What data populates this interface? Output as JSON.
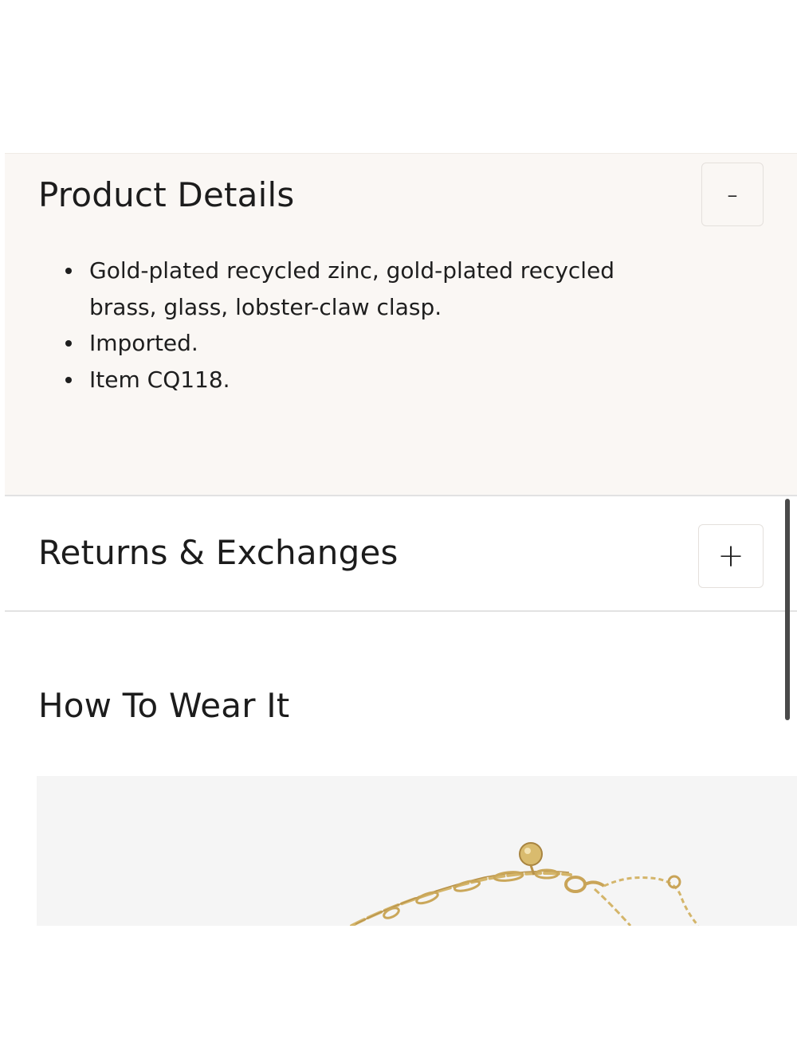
{
  "product_details": {
    "title": "Product Details",
    "toggle_symbol": "-",
    "items": [
      "Gold-plated recycled zinc, gold-plated recycled brass, glass, lobster-claw clasp.",
      "Imported.",
      "Item CQ118."
    ]
  },
  "returns": {
    "title": "Returns & Exchanges",
    "toggle_symbol": "+"
  },
  "how_to_wear": {
    "title": "How To Wear It",
    "image_icon": "gold-chain-necklace-photo"
  },
  "colors": {
    "details_background": "#faf7f4",
    "divider": "#e2e2e2",
    "text": "#1c1c1c",
    "image_background": "#f5f5f5",
    "gold": "#d6b66a"
  }
}
